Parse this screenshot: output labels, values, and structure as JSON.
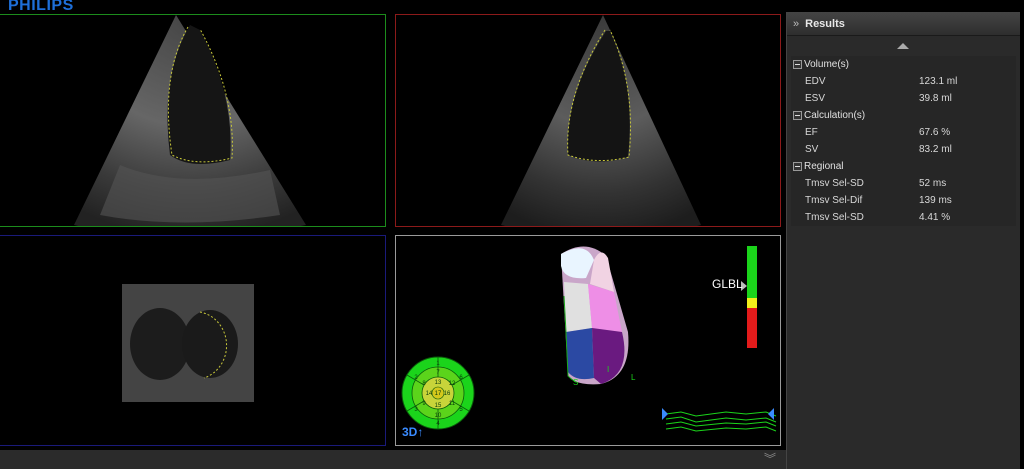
{
  "brand": {
    "name": "PHILIPS",
    "color": "#1e6fd9"
  },
  "viewer": {
    "panes": {
      "top_left": {
        "border_color": "#1c8c1c"
      },
      "top_right": {
        "border_color": "#8c1a1a"
      },
      "bottom_left": {
        "border_color": "#1a1a7a"
      },
      "bottom_right": {
        "border_color": "#9a9a9a"
      }
    },
    "model": {
      "glbl_label": "GLBL",
      "label_3d": "3D",
      "axis_labels": [
        "S",
        "I",
        "L"
      ]
    },
    "bullseye": {
      "segments": [
        "1",
        "2",
        "3",
        "4",
        "5",
        "6",
        "7",
        "8",
        "9",
        "10",
        "11",
        "12",
        "13",
        "14",
        "15",
        "16",
        "17"
      ]
    },
    "bottom_bar": {
      "icon": "double-chevron-down-icon"
    }
  },
  "results": {
    "title": "Results",
    "icon": "double-chevron-right-icon",
    "groups": [
      {
        "label": "Volume(s)",
        "items": [
          {
            "key": "EDV",
            "value": "123.1 ml"
          },
          {
            "key": "ESV",
            "value": "39.8 ml"
          }
        ]
      },
      {
        "label": "Calculation(s)",
        "items": [
          {
            "key": "EF",
            "value": "67.6 %"
          },
          {
            "key": "SV",
            "value": "83.2 ml"
          }
        ]
      },
      {
        "label": "Regional",
        "items": [
          {
            "key": "Tmsv Sel-SD",
            "value": "52 ms"
          },
          {
            "key": "Tmsv Sel-Dif",
            "value": "139 ms"
          },
          {
            "key": "Tmsv Sel-SD",
            "value": "4.41 %"
          }
        ]
      }
    ]
  }
}
